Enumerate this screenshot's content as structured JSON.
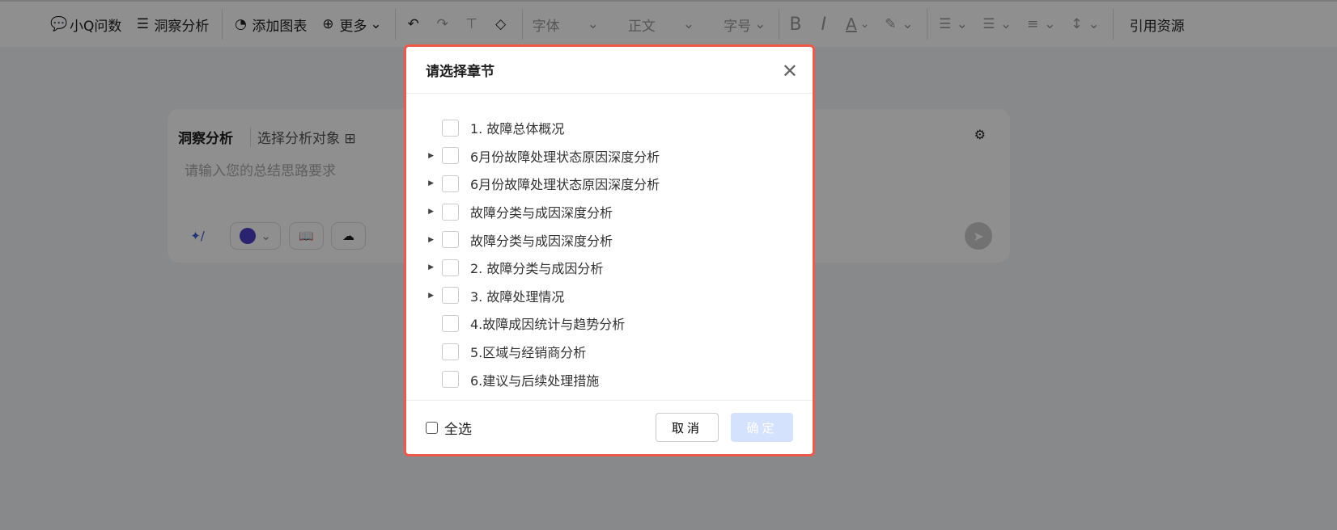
{
  "toolbar": {
    "ask": "小Q问数",
    "insight": "洞察分析",
    "add_chart": "添加图表",
    "more": "更多",
    "font": "字体",
    "style": "正文",
    "size": "字号",
    "bold": "B",
    "italic": "I",
    "font_color": "A",
    "cite": "引用资源"
  },
  "card": {
    "title": "洞察分析",
    "select_object": "选择分析对象",
    "placeholder": "请输入您的总结思路要求"
  },
  "modal": {
    "title": "请选择章节",
    "items": [
      {
        "label": "1. 故障总体概况",
        "expandable": false
      },
      {
        "label": "6月份故障处理状态原因深度分析",
        "expandable": true
      },
      {
        "label": "6月份故障处理状态原因深度分析",
        "expandable": true
      },
      {
        "label": "故障分类与成因深度分析",
        "expandable": true
      },
      {
        "label": "故障分类与成因深度分析",
        "expandable": true
      },
      {
        "label": "2. 故障分类与成因分析",
        "expandable": true
      },
      {
        "label": "3. 故障处理情况",
        "expandable": true
      },
      {
        "label": "4.故障成因统计与趋势分析",
        "expandable": false
      },
      {
        "label": "5.区域与经销商分析",
        "expandable": false
      },
      {
        "label": "6.建议与后续处理措施",
        "expandable": false
      }
    ],
    "select_all": "全选",
    "cancel": "取消",
    "confirm": "确定"
  },
  "colors": {
    "highlight_border": "#f0584a",
    "confirm_disabled": "#d4e2fd"
  }
}
